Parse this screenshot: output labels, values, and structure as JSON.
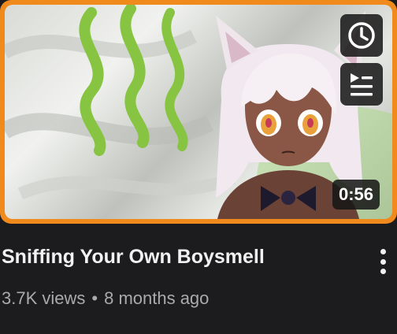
{
  "video": {
    "title": "Sniffing Your Own Boysmell",
    "views": "3.7K views",
    "separator": "•",
    "age": "8 months ago",
    "duration": "0:56"
  },
  "thumbnail": {
    "border_color": "#f08a1c",
    "accent_green": "#86c442"
  },
  "overlay_icons": {
    "watch_later": "clock-icon",
    "add_to_queue": "queue-icon"
  },
  "menu": {
    "icon": "more-vertical-icon"
  }
}
